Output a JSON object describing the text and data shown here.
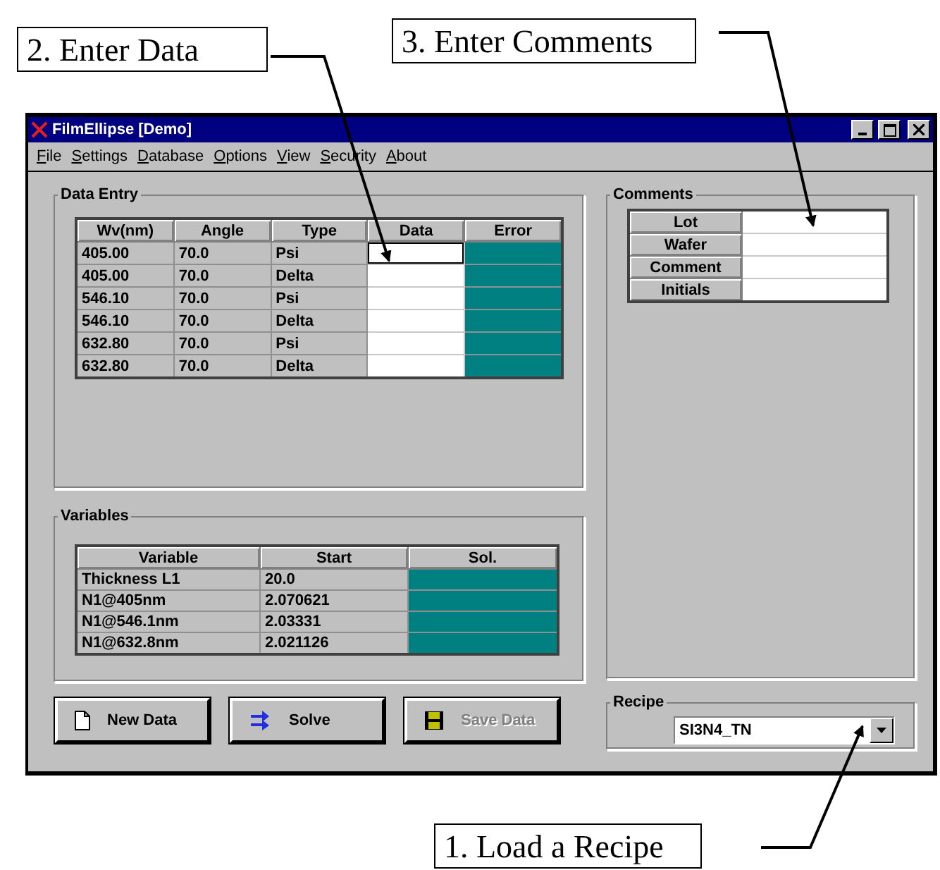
{
  "annotations": [
    "2.  Enter Data",
    "3. Enter Comments",
    "1. Load a Recipe"
  ],
  "window": {
    "title": "FilmEllipse [Demo]"
  },
  "menu": [
    "File",
    "Settings",
    "Database",
    "Options",
    "View",
    "Security",
    "About"
  ],
  "data_entry": {
    "title": "Data Entry",
    "columns": [
      "Wv(nm)",
      "Angle",
      "Type",
      "Data",
      "Error"
    ],
    "rows": [
      {
        "cells": [
          "405.00",
          "70.0",
          "Psi"
        ],
        "focused": true
      },
      {
        "cells": [
          "405.00",
          "70.0",
          "Delta"
        ],
        "focused": false
      },
      {
        "cells": [
          "546.10",
          "70.0",
          "Psi"
        ],
        "focused": false
      },
      {
        "cells": [
          "546.10",
          "70.0",
          "Delta"
        ],
        "focused": false
      },
      {
        "cells": [
          "632.80",
          "70.0",
          "Psi"
        ],
        "focused": false
      },
      {
        "cells": [
          "632.80",
          "70.0",
          "Delta"
        ],
        "focused": false
      }
    ]
  },
  "variables": {
    "title": "Variables",
    "columns": [
      "Variable",
      "Start",
      "Sol."
    ],
    "rows": [
      [
        "Thickness L1",
        "20.0"
      ],
      [
        "N1@405nm",
        "2.070621"
      ],
      [
        "N1@546.1nm",
        "2.03331"
      ],
      [
        "N1@632.8nm",
        "2.021126"
      ]
    ]
  },
  "buttons": [
    {
      "kind": "new",
      "label": "New Data",
      "disabled": false
    },
    {
      "kind": "solve",
      "label": "Solve",
      "disabled": false
    },
    {
      "kind": "save",
      "label": "Save Data",
      "disabled": true
    }
  ],
  "comments": {
    "title": "Comments",
    "fields": [
      "Lot",
      "Wafer",
      "Comment",
      "Initials"
    ]
  },
  "recipe": {
    "title": "Recipe",
    "value": "SI3N4_TN"
  }
}
